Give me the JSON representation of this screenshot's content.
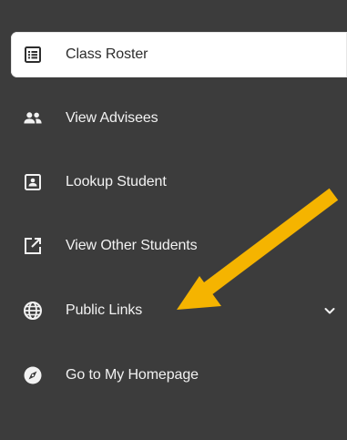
{
  "nav": {
    "items": [
      {
        "label": "Class Roster",
        "icon": "list-icon",
        "active": true
      },
      {
        "label": "View Advisees",
        "icon": "people-icon",
        "active": false
      },
      {
        "label": "Lookup Student",
        "icon": "id-card-icon",
        "active": false
      },
      {
        "label": "View Other Students",
        "icon": "external-link-icon",
        "active": false
      },
      {
        "label": "Public Links",
        "icon": "globe-icon",
        "active": false,
        "expandable": true
      },
      {
        "label": "Go to My Homepage",
        "icon": "compass-icon",
        "active": false
      }
    ]
  },
  "annotation": {
    "arrow_color": "#f5b400",
    "target": "Public Links"
  },
  "colors": {
    "sidebar_bg": "#3c3c3c",
    "active_bg": "#ffffff",
    "text": "#f2f2f2",
    "active_text": "#2d2d2d"
  }
}
